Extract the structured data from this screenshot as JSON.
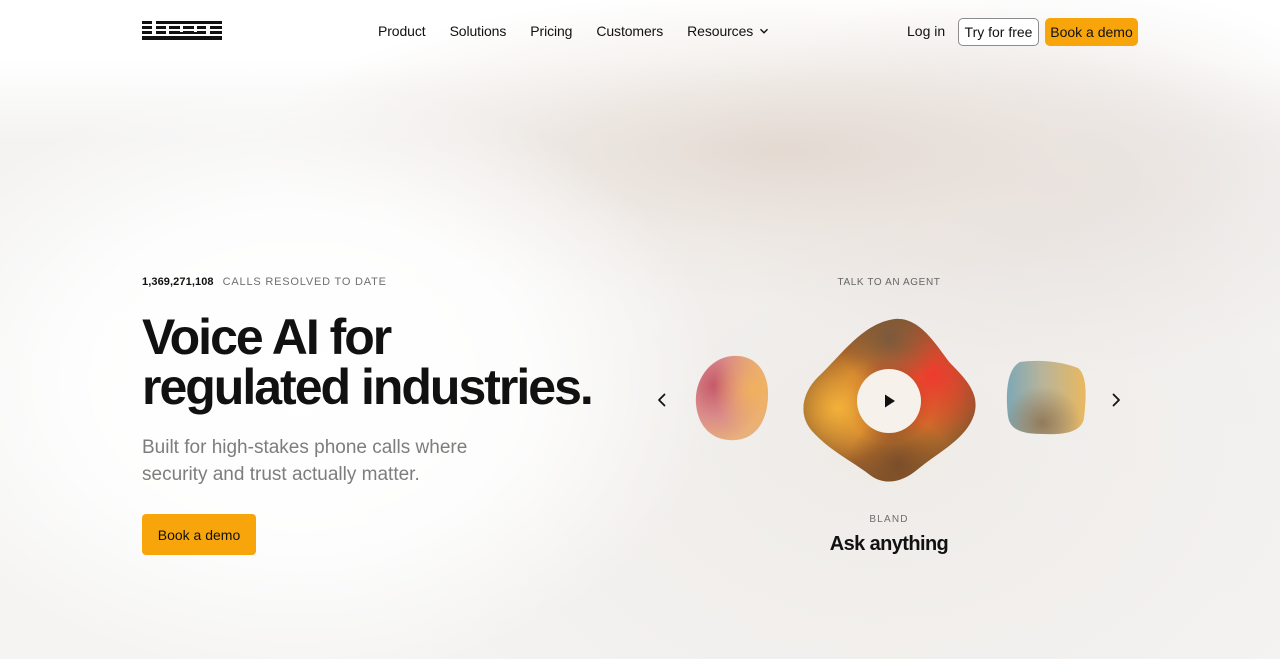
{
  "nav": {
    "logo_text": "bland",
    "links": [
      "Product",
      "Solutions",
      "Pricing",
      "Customers",
      "Resources"
    ],
    "login": "Log in",
    "try_free": "Try for free",
    "book_demo": "Book a demo"
  },
  "hero": {
    "stat_number": "1,369,271,108",
    "stat_label": "CALLS RESOLVED TO DATE",
    "headline_line1": "Voice AI for",
    "headline_line2": "regulated industries.",
    "subheading": "Built for high-stakes phone calls where security and trust actually matter.",
    "cta": "Book a demo"
  },
  "agent": {
    "section_title": "TALK TO AN AGENT",
    "name": "BLAND",
    "caption": "Ask anything"
  },
  "icons": [
    "chevron-down-icon",
    "chevron-left-icon",
    "chevron-right-icon",
    "play-icon"
  ],
  "colors": {
    "accent": "#f8a50c",
    "text": "#111111",
    "muted": "#7d7d7d"
  }
}
